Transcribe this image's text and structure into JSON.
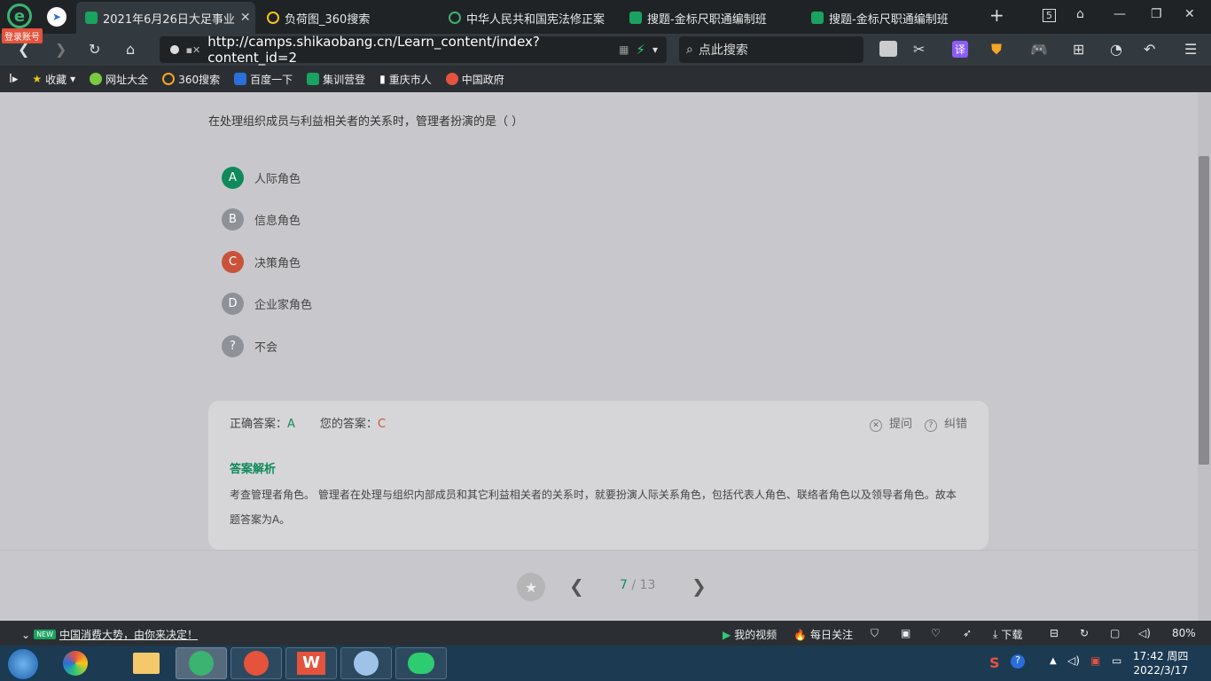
{
  "browser": {
    "login_badge": "登录账号",
    "tabs": [
      {
        "title": "2021年6月26日大足事业",
        "active": true,
        "icon_color": "#1aa260"
      },
      {
        "title": "负荷图_360搜索",
        "active": false,
        "icon_color": "#f5c518"
      },
      {
        "title": "中华人民共和国宪法修正案",
        "active": false,
        "icon_color": "#3cb371"
      },
      {
        "title": "搜题-金标尺职通编制班",
        "active": false,
        "icon_color": "#1aa260"
      },
      {
        "title": "搜题-金标尺职通编制班",
        "active": false,
        "icon_color": "#1aa260"
      }
    ],
    "tab_count": "5",
    "url": "http://camps.shikaobang.cn/Learn_content/index?content_id=2",
    "search_placeholder": "点此搜索"
  },
  "bookmarks": [
    {
      "label": "收藏",
      "icon": "star-icon",
      "color": "#f5c518"
    },
    {
      "label": "网址大全",
      "icon": "globe-icon",
      "color": "#7ac943"
    },
    {
      "label": "360搜索",
      "icon": "search-360-icon",
      "color": "#f5a623"
    },
    {
      "label": "百度一下",
      "icon": "baidu-icon",
      "color": "#2a6fdb"
    },
    {
      "label": "集训营登",
      "icon": "camp-icon",
      "color": "#1aa260"
    },
    {
      "label": "重庆市人",
      "icon": "document-icon",
      "color": "#ffffff"
    },
    {
      "label": "中国政府",
      "icon": "emblem-icon",
      "color": "#e5533d"
    }
  ],
  "quiz": {
    "question": "在处理组织成员与利益相关者的关系时，管理者扮演的是（   ）",
    "options": [
      {
        "letter": "A",
        "text": "人际角色",
        "state": "correct"
      },
      {
        "letter": "B",
        "text": "信息角色",
        "state": "normal"
      },
      {
        "letter": "C",
        "text": "决策角色",
        "state": "wrong"
      },
      {
        "letter": "D",
        "text": "企业家角色",
        "state": "normal"
      },
      {
        "letter": "?",
        "text": "不会",
        "state": "normal"
      }
    ],
    "correct_label": "正确答案：",
    "correct_value": "A",
    "your_label": "您的答案：",
    "your_value": "C",
    "ask_label": "提问",
    "report_label": "纠错",
    "analysis_title": "答案解析",
    "analysis_text": "考查管理者角色。 管理者在处理与组织内部成员和其它利益相关者的关系时，就要扮演人际关系角色，包括代表人角色、联络者角色以及领导者角色。故本题答案为A。",
    "page_current": "7",
    "page_sep": " / ",
    "page_total": "13"
  },
  "statusbar": {
    "news_badge": "NEW",
    "news": "中国消费大势，由你来决定！",
    "my_video": "我的视频",
    "daily": "每日关注",
    "download": "下载",
    "zoom": "80%"
  },
  "taskbar": {
    "time": "17:42 周四",
    "date": "2022/3/17"
  }
}
